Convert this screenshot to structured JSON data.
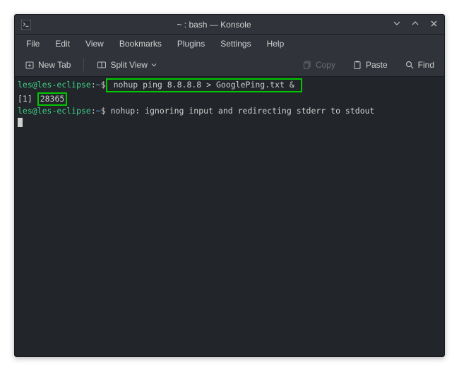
{
  "window": {
    "title": "~ : bash — Konsole"
  },
  "menubar": {
    "items": [
      "File",
      "Edit",
      "View",
      "Bookmarks",
      "Plugins",
      "Settings",
      "Help"
    ]
  },
  "toolbar": {
    "newtab": "New Tab",
    "splitview": "Split View",
    "copy": "Copy",
    "paste": "Paste",
    "find": "Find"
  },
  "terminal": {
    "prompt_user": "les@les-eclipse",
    "prompt_sep": ":",
    "prompt_path": "~",
    "prompt_dollar": "$",
    "line1_cmd": " nohup ping 8.8.8.8 > GooglePing.txt & ",
    "line2_pre": "[1] ",
    "line2_pid": "28365",
    "line3_out": " nohup: ignoring input and redirecting stderr to stdout"
  }
}
